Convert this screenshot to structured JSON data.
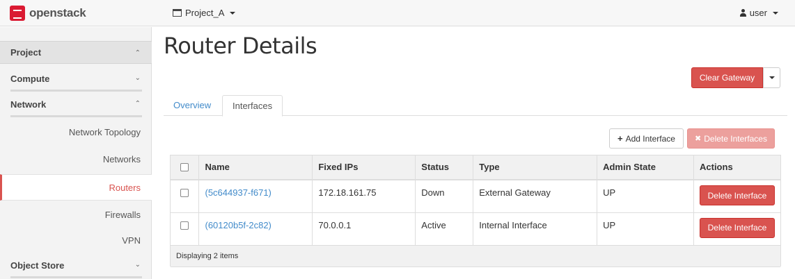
{
  "header": {
    "logo_text": "openstack",
    "project": "Project_A",
    "user": "user"
  },
  "sidebar": {
    "project_label": "Project",
    "sections": [
      {
        "label": "Compute"
      },
      {
        "label": "Network"
      }
    ],
    "network_items": [
      {
        "label": "Network Topology"
      },
      {
        "label": "Networks"
      },
      {
        "label": "Routers",
        "active": true
      },
      {
        "label": "Firewalls"
      },
      {
        "label": "VPN"
      }
    ],
    "object_store_label": "Object Store"
  },
  "main": {
    "title": "Router Details",
    "clear_gateway_label": "Clear Gateway",
    "tabs": [
      {
        "label": "Overview"
      },
      {
        "label": "Interfaces",
        "active": true
      }
    ],
    "add_interface_label": "Add Interface",
    "delete_interfaces_label": "Delete Interfaces",
    "table": {
      "columns": [
        "Name",
        "Fixed IPs",
        "Status",
        "Type",
        "Admin State",
        "Actions"
      ],
      "rows": [
        {
          "name": "(5c644937-f671)",
          "fixed_ips": "172.18.161.75",
          "status": "Down",
          "type": "External Gateway",
          "admin_state": "UP",
          "action": "Delete Interface"
        },
        {
          "name": "(60120b5f-2c82)",
          "fixed_ips": "70.0.0.1",
          "status": "Active",
          "type": "Internal Interface",
          "admin_state": "UP",
          "action": "Delete Interface"
        }
      ],
      "footer": "Displaying 2 items"
    }
  },
  "colors": {
    "accent_red": "#d9534f",
    "link_blue": "#428bca"
  }
}
